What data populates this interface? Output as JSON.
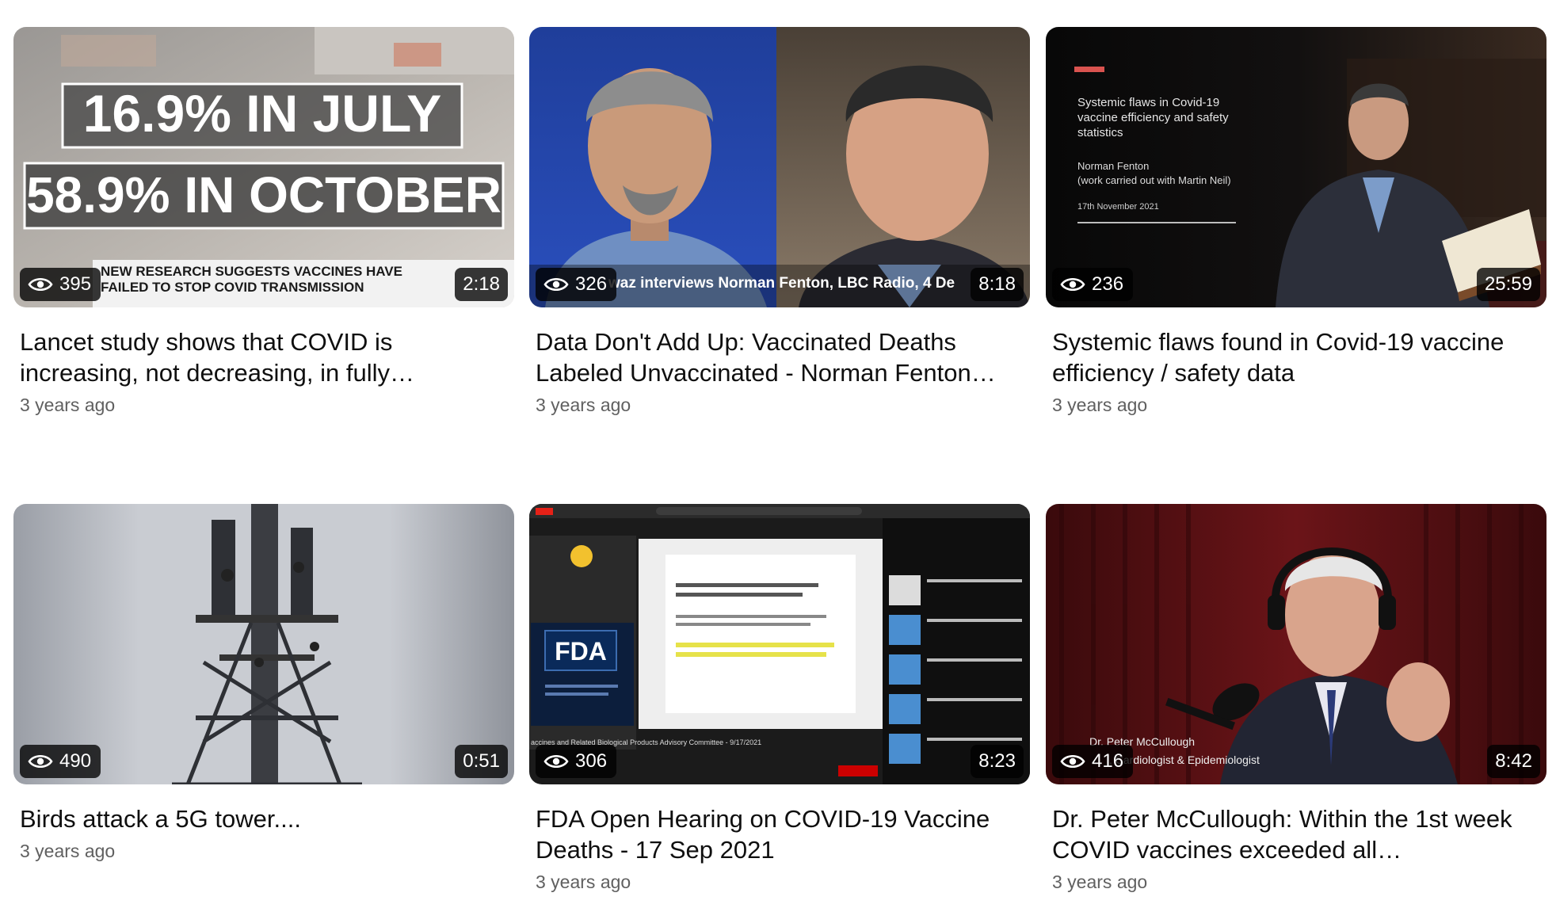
{
  "videos": [
    {
      "title": "Lancet study shows that COVID is increasing, not decreasing, in fully…",
      "age": "3 years ago",
      "views": "395",
      "duration": "2:18",
      "thumb_text": {
        "line1": "16.9% IN JULY",
        "line2": "58.9% IN OCTOBER",
        "banner1": "NEW RESEARCH SUGGESTS VACCINES HAVE",
        "banner2": "FAILED TO STOP COVID TRANSMISSION"
      }
    },
    {
      "title": "Data Don't Add Up: Vaccinated Deaths Labeled Unvaccinated - Norman Fenton…",
      "age": "3 years ago",
      "views": "326",
      "duration": "8:18",
      "thumb_text": {
        "caption": "waz interviews Norman Fenton, LBC Radio, 4 De"
      }
    },
    {
      "title": "Systemic flaws found in Covid-19 vaccine efficiency / safety data",
      "age": "3 years ago",
      "views": "236",
      "duration": "25:59",
      "thumb_text": {
        "slide1": "Systemic flaws in Covid-19",
        "slide2": "vaccine efficiency and safety",
        "slide3": "statistics",
        "author": "Norman Fenton",
        "note": "(work carried out with Martin Neil)",
        "date": "17th November 2021"
      }
    },
    {
      "title": "Birds attack a 5G tower....",
      "age": "3 years ago",
      "views": "490",
      "duration": "0:51",
      "thumb_text": {}
    },
    {
      "title": "FDA Open Hearing on COVID-19 Vaccine Deaths - 17 Sep 2021",
      "age": "3 years ago",
      "views": "306",
      "duration": "8:23",
      "thumb_text": {
        "logo": "FDA",
        "bottom_caption": "accines and Related Biological Products Advisory Committee - 9/17/2021"
      }
    },
    {
      "title": "Dr. Peter McCullough: Within the 1st week COVID vaccines exceeded all…",
      "age": "3 years ago",
      "views": "416",
      "duration": "8:42",
      "thumb_text": {
        "lower_third1": "Dr. Peter McCullough",
        "lower_third2": ", Cardiologist & Epidemiologist"
      }
    }
  ]
}
